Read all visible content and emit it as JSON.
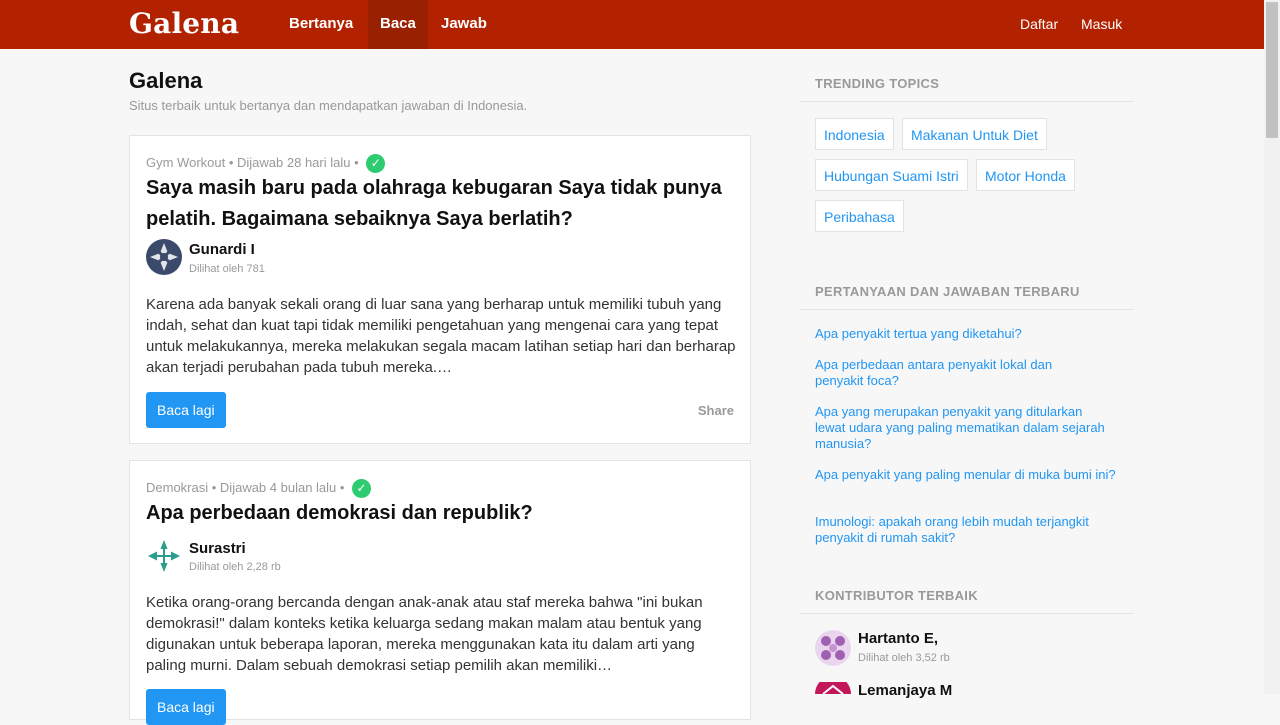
{
  "nav": {
    "brand": "Galena",
    "links": [
      "Bertanya",
      "Baca",
      "Jawab"
    ],
    "active": "Baca",
    "right": [
      "Daftar",
      "Masuk"
    ]
  },
  "page": {
    "title": "Galena",
    "subtitle": "Situs terbaik untuk bertanya dan mendapatkan jawaban di Indonesia."
  },
  "cards": [
    {
      "topic": "Gym Workout",
      "answered": "Dijawab 28 hari lalu",
      "title": "Saya masih baru pada olahraga kebugaran Saya tidak punya pelatih. Bagaimana sebaiknya Saya berlatih?",
      "author": "Gunardi I",
      "views": "Dilihat oleh 781",
      "excerpt": "Karena ada banyak sekali orang di luar sana yang berharap untuk memiliki tubuh yang indah, sehat dan kuat tapi tidak memiliki pengetahuan yang mengenai cara yang tepat untuk melakukannya, mereka melakukan segala macam latihan setiap hari dan berharap akan terjadi perubahan pada tubuh mereka.…",
      "read_more": "Baca lagi",
      "share": "Share"
    },
    {
      "topic": "Demokrasi",
      "answered": "Dijawab 4 bulan lalu",
      "title": "Apa perbedaan demokrasi dan republik?",
      "author": "Surastri",
      "views": "Dilihat oleh 2,28 rb",
      "excerpt": "Ketika orang-orang bercanda dengan anak-anak atau staf mereka bahwa \"ini bukan demokrasi!\" dalam konteks ketika keluarga sedang makan malam atau bentuk yang digunakan untuk beberapa laporan, mereka menggunakan kata itu dalam arti yang paling murni. Dalam sebuah demokrasi setiap pemilih akan memiliki…",
      "read_more": "Baca lagi"
    }
  ],
  "sidebar": {
    "trending_heading": "TRENDING TOPICS",
    "tags": [
      "Indonesia",
      "Makanan Untuk Diet",
      "Hubungan Suami Istri",
      "Motor Honda",
      "Peribahasa"
    ],
    "recent_heading": "PERTANYAAN DAN JAWABAN TERBARU",
    "recent": [
      "Apa penyakit tertua yang diketahui?",
      "Apa perbedaan antara penyakit lokal dan penyakit foca?",
      "Apa yang merupakan penyakit yang ditularkan lewat udara yang paling mematikan dalam sejarah manusia?",
      "Apa penyakit yang paling menular di muka bumi ini?",
      "Imunologi: apakah orang lebih mudah terjangkit penyakit di rumah sakit?"
    ],
    "contrib_heading": "KONTRIBUTOR TERBAIK",
    "contributors": [
      {
        "name": "Hartanto E,",
        "views": "Dilihat oleh 3,52 rb"
      },
      {
        "name": "Lemanjaya M"
      }
    ]
  },
  "colors": {
    "brand_red": "#b22200",
    "active_tab": "#992000",
    "link_blue": "#2196f3",
    "check_green": "#2ecc71"
  }
}
